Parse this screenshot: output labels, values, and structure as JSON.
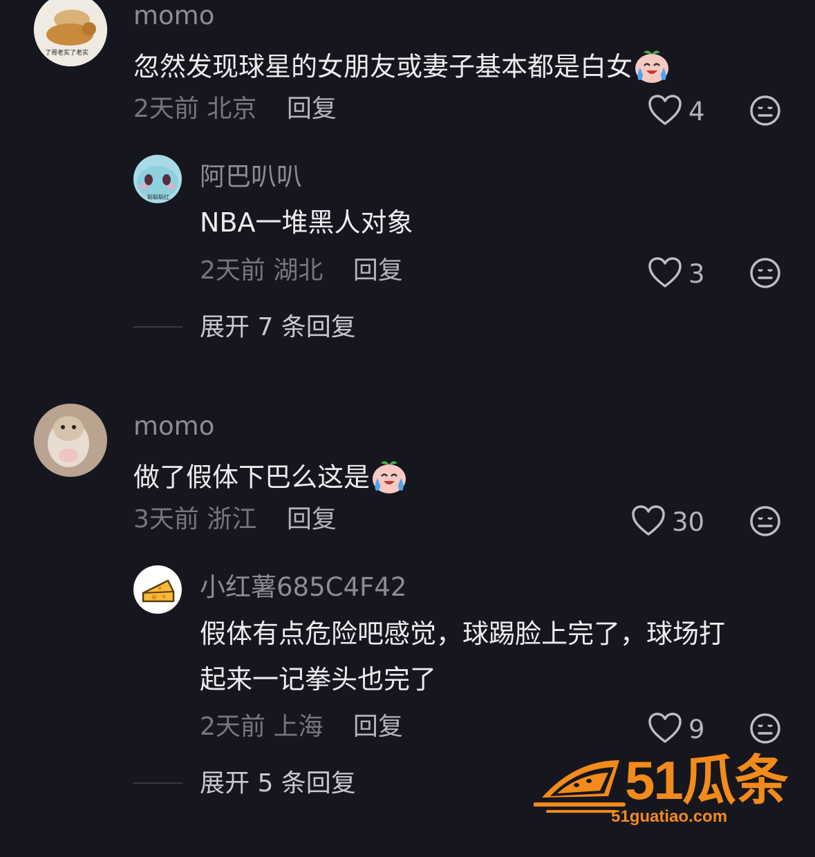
{
  "comments": [
    {
      "username": "momo",
      "avatar_caption": "了哥老实了老实",
      "text": "忽然发现球星的女朋友或妻子基本都是白女",
      "emoji": "crying-laughing-emoji",
      "time": "2天前",
      "location": "北京",
      "reply_label": "回复",
      "likes": "4",
      "replies": [
        {
          "username": "阿巴叭叭",
          "avatar_caption": "聪聪聪红",
          "text": "NBA一堆黑人对象",
          "time": "2天前",
          "location": "湖北",
          "reply_label": "回复",
          "likes": "3"
        }
      ],
      "expand_label": "展开 7 条回复"
    },
    {
      "username": "momo",
      "text": "做了假体下巴么这是",
      "emoji": "crying-laughing-emoji",
      "time": "3天前",
      "location": "浙江",
      "reply_label": "回复",
      "likes": "30",
      "replies": [
        {
          "username": "小红薯685C4F42",
          "text_line1": "假体有点危险吧感觉，球踢脸上完了，球场打",
          "text_line2": "起来一记拳头也完了",
          "time": "2天前",
          "location": "上海",
          "reply_label": "回复",
          "likes": "9"
        }
      ],
      "expand_label": "展开 5 条回复"
    }
  ],
  "watermark": {
    "brand": "51瓜条",
    "url": "51guatiao.com"
  },
  "colors": {
    "background": "#16161e",
    "accent": "#f28a1c"
  },
  "icons": [
    "heart-outline-icon",
    "neutral-face-icon"
  ]
}
